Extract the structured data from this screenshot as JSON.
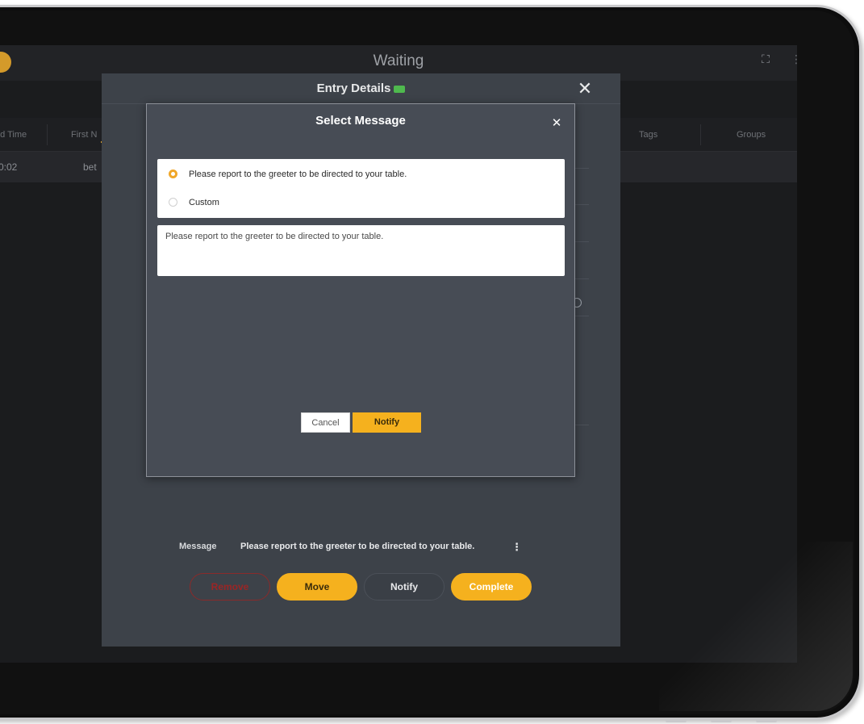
{
  "app": {
    "header_title": "Waiting"
  },
  "table": {
    "columns": [
      "ed Time",
      "First N",
      "Tags",
      "Groups"
    ],
    "row": {
      "time": "0:02",
      "first_name": "bet"
    }
  },
  "entry_details": {
    "title": "Entry Details",
    "close_glyph": "✕",
    "message_label": "Message",
    "message_text": "Please report to the greeter to be directed to your table.",
    "message_menu_glyph": "⋮",
    "actions": {
      "remove": "Remove",
      "move": "Move",
      "notify": "Notify",
      "complete": "Complete"
    }
  },
  "select_message": {
    "title": "Select Message",
    "close_glyph": "✕",
    "options": [
      {
        "label": "Please report to the greeter to be directed to your table.",
        "selected": true
      },
      {
        "label": "Custom",
        "selected": false
      }
    ],
    "textarea_value": "Please report to the greeter to be directed to your table.",
    "cancel_label": "Cancel",
    "notify_label": "Notify"
  },
  "icons": {
    "expand": "expand-icon",
    "more": "more-vertical-icon",
    "ticket": "ticket-icon",
    "close": "close-icon"
  },
  "colors": {
    "accent": "#f5b11e",
    "danger": "#9b2525",
    "ticket_green": "#4fb94e",
    "dialog_bg": "#474c55",
    "modal_bg": "#3d4249"
  }
}
